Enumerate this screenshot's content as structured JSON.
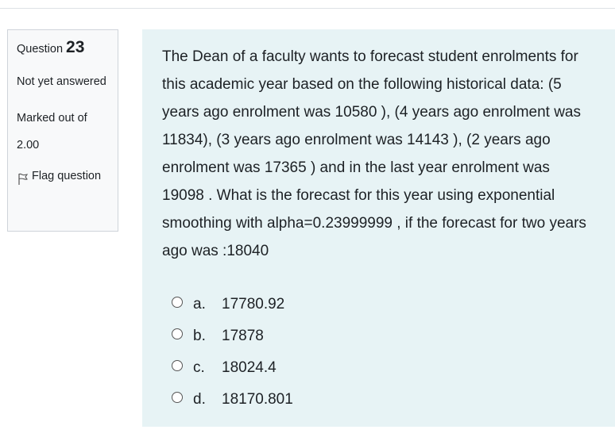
{
  "question_info": {
    "label": "Question",
    "number": "23",
    "state": "Not yet answered",
    "grade": "Marked out of 2.00",
    "flag_label": "Flag question"
  },
  "question": {
    "text": "The Dean of a faculty wants to forecast student enrolments for this academic year based on the following historical data: (5 years ago enrolment was 10580 ), (4 years ago enrolment was 11834), (3 years ago enrolment was 14143 ), (2 years ago enrolment was 17365 ) and in the last year enrolment was 19098 . What is the forecast for this year using exponential smoothing with alpha=0.23999999 , if the forecast for two years ago was :18040",
    "options": [
      {
        "letter": "a.",
        "value": "17780.92"
      },
      {
        "letter": "b.",
        "value": "17878"
      },
      {
        "letter": "c.",
        "value": "18024.4"
      },
      {
        "letter": "d.",
        "value": "18170.801"
      }
    ]
  },
  "icons": {
    "flag": "flag-icon",
    "radio": "radio-unchecked-icon"
  },
  "colors": {
    "content_bg": "#e7f3f5",
    "info_bg": "#f8f9fa",
    "border": "#cfd4da",
    "text": "#1d2125"
  }
}
